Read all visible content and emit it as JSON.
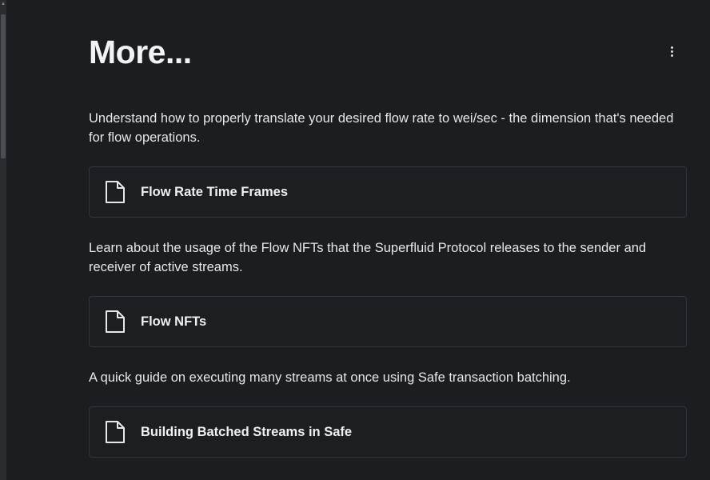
{
  "page": {
    "title": "More..."
  },
  "sections": [
    {
      "description": "Understand how to properly translate your desired flow rate to wei/sec - the dimension that's needed for flow operations.",
      "card_label": "Flow Rate Time Frames",
      "icon": "document-icon"
    },
    {
      "description": "Learn about the usage of the Flow NFTs that the Superfluid Protocol releases to the sender and receiver of active streams.",
      "card_label": "Flow NFTs",
      "icon": "document-icon"
    },
    {
      "description": "A quick guide on executing many streams at once using Safe transaction batching.",
      "card_label": "Building Batched Streams in Safe",
      "icon": "document-icon"
    }
  ],
  "menu": {
    "icon": "kebab-menu-icon"
  }
}
